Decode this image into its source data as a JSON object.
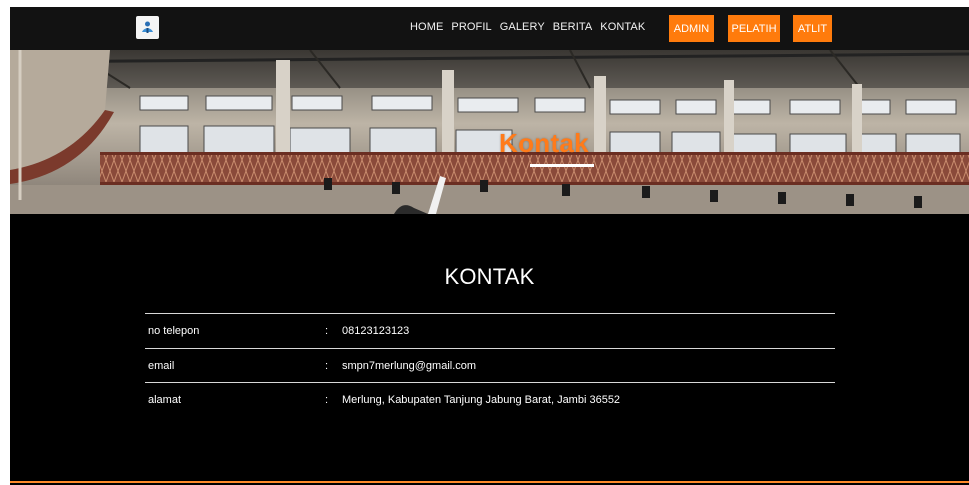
{
  "nav": {
    "logo_icon": "school-logo-icon",
    "links": [
      "HOME",
      "PROFIL",
      "GALERY",
      "BERITA",
      "KONTAK"
    ],
    "buttons": {
      "admin": "ADMIN",
      "pelatih": "PELATIH",
      "atlit": "ATLIT"
    },
    "accent": "#ff7b0c"
  },
  "hero": {
    "title": "Kontak",
    "title_color": "#ff7b1a"
  },
  "content": {
    "title": "KONTAK",
    "rows": [
      {
        "label": "no telepon",
        "sep": ":",
        "value": "08123123123"
      },
      {
        "label": "email",
        "sep": ":",
        "value": "smpn7merlung@gmail.com"
      },
      {
        "label": "alamat",
        "sep": ":",
        "value": "Merlung, Kabupaten Tanjung Jabung Barat, Jambi 36552"
      }
    ]
  }
}
